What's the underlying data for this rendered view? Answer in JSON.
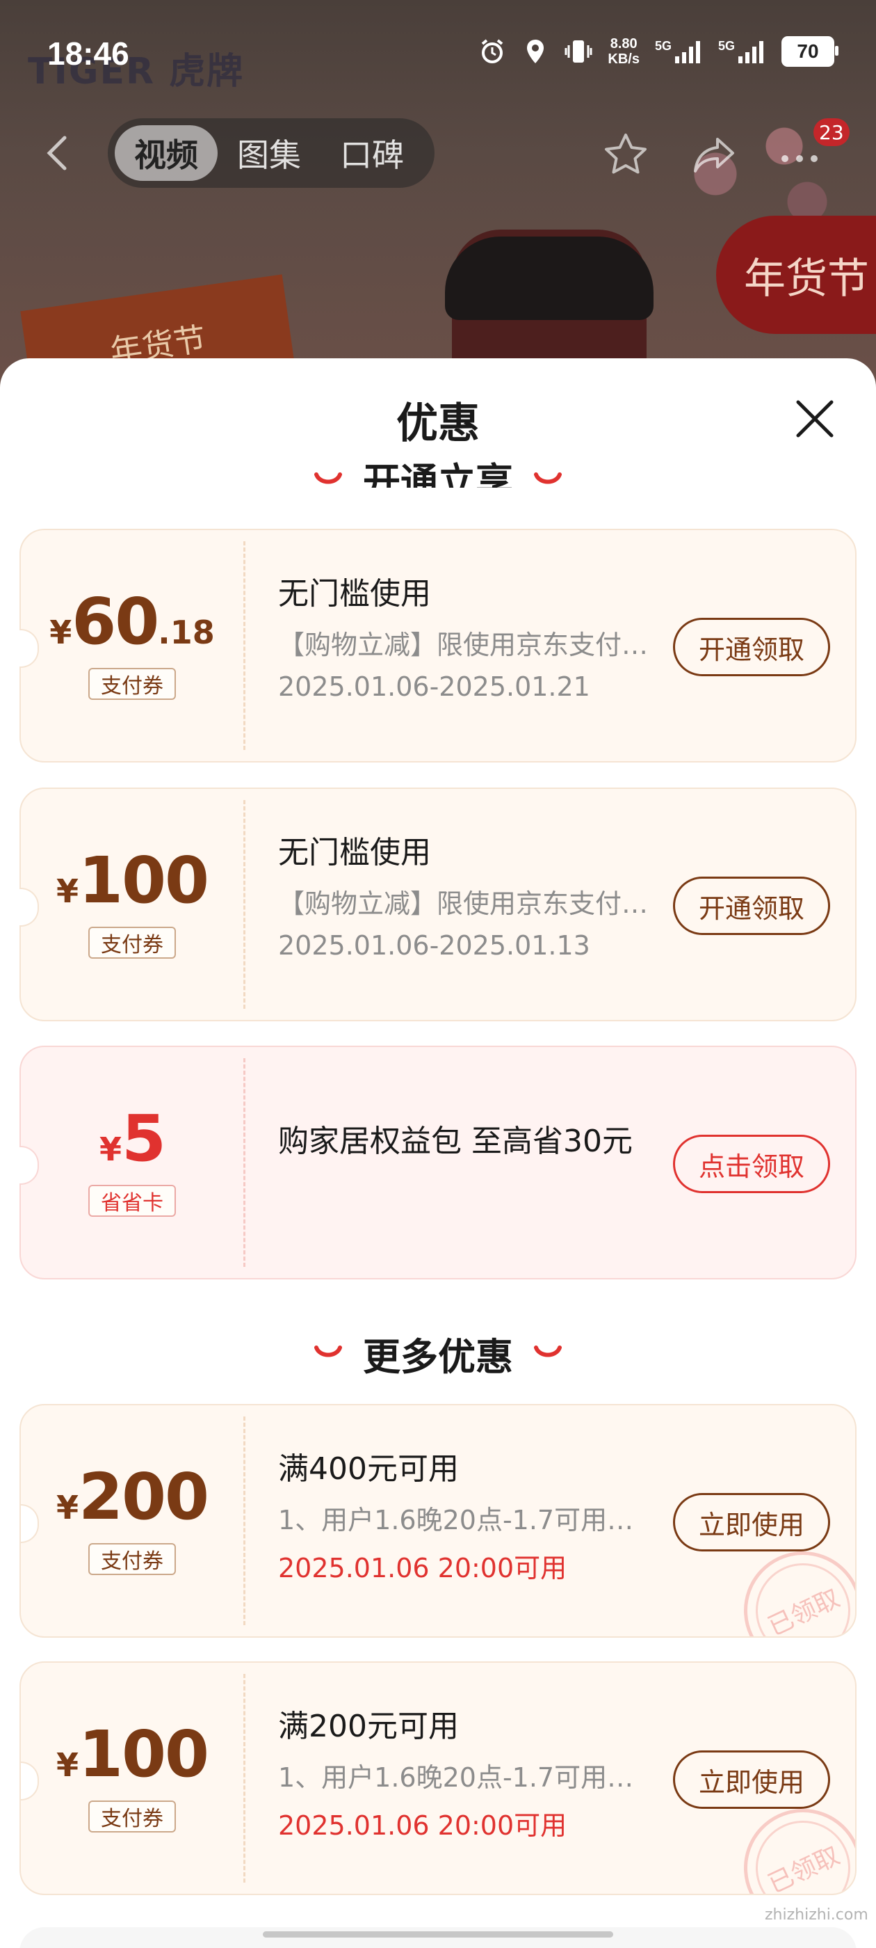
{
  "status_bar": {
    "time": "18:46",
    "net_speed_value": "8.80",
    "net_speed_unit": "KB/s",
    "sim1": "5G",
    "sim2": "5G",
    "battery": "70"
  },
  "hero": {
    "brand_logo": "TIGER 虎牌",
    "promo_text_right": "年货节",
    "promo_text_left": "年货节"
  },
  "nav": {
    "tabs": [
      {
        "label": "视频",
        "active": true
      },
      {
        "label": "图集",
        "active": false
      },
      {
        "label": "口碑",
        "active": false
      }
    ],
    "more_badge": "23"
  },
  "sheet": {
    "title": "优惠",
    "section_partial": "开通立享",
    "section_more": "更多优惠"
  },
  "coupons_top": [
    {
      "yen": "¥",
      "int": "60",
      "dec": ".18",
      "tag": "支付券",
      "title": "无门槛使用",
      "desc": "【购物立减】限使用京东支付…",
      "date": "2025.01.06-2025.01.21",
      "button": "开通领取"
    },
    {
      "yen": "¥",
      "int": "100",
      "dec": "",
      "tag": "支付券",
      "title": "无门槛使用",
      "desc": "【购物立减】限使用京东支付…",
      "date": "2025.01.06-2025.01.13",
      "button": "开通领取"
    },
    {
      "yen": "¥",
      "int": "5",
      "dec": "",
      "tag": "省省卡",
      "title": "购家居权益包 至高省30元",
      "button": "点击领取"
    }
  ],
  "coupons_more": [
    {
      "yen": "¥",
      "int": "200",
      "tag": "支付券",
      "title": "满400元可用",
      "desc": "1、用户1.6晚20点-1.7可用…",
      "date": "2025.01.06 20:00可用",
      "button": "立即使用",
      "stamp": "已领取"
    },
    {
      "yen": "¥",
      "int": "100",
      "tag": "支付券",
      "title": "满200元可用",
      "desc": "1、用户1.6晚20点-1.7可用…",
      "date": "2025.01.06 20:00可用",
      "button": "立即使用",
      "stamp": "已领取"
    }
  ],
  "watermark": "zhizhizhi.com",
  "colors": {
    "brown": "#7a3a14",
    "red": "#e0322f",
    "coupon_bg": "#fff8f1",
    "pink_bg": "#fff3f2"
  }
}
